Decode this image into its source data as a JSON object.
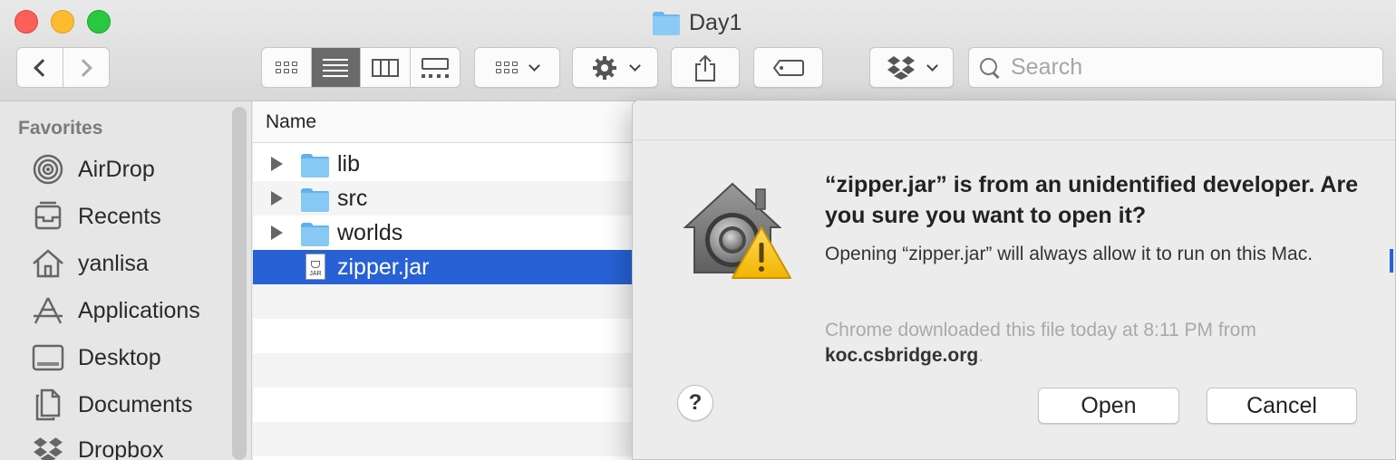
{
  "window": {
    "title": "Day1"
  },
  "toolbar": {
    "search_placeholder": "Search"
  },
  "sidebar": {
    "section": "Favorites",
    "items": [
      {
        "label": "AirDrop",
        "icon": "airdrop-icon"
      },
      {
        "label": "Recents",
        "icon": "recents-icon"
      },
      {
        "label": "yanlisa",
        "icon": "home-icon"
      },
      {
        "label": "Applications",
        "icon": "applications-icon"
      },
      {
        "label": "Desktop",
        "icon": "desktop-icon"
      },
      {
        "label": "Documents",
        "icon": "documents-icon"
      },
      {
        "label": "Dropbox",
        "icon": "dropbox-icon"
      }
    ]
  },
  "filelist": {
    "column_name": "Name",
    "rows": [
      {
        "name": "lib",
        "type": "folder"
      },
      {
        "name": "src",
        "type": "folder"
      },
      {
        "name": "worlds",
        "type": "folder"
      },
      {
        "name": "zipper.jar",
        "type": "jar",
        "selected": true
      }
    ],
    "jar_badge": "JAR"
  },
  "dialog": {
    "title": "“zipper.jar” is from an unidentified developer. Are you sure you want to open it?",
    "message": "Opening “zipper.jar” will always allow it to run on this Mac.",
    "source_prefix": "Chrome downloaded this file today at 8:11 PM from",
    "source_domain": "koc.csbridge.org",
    "source_suffix": ".",
    "help_label": "?",
    "open_label": "Open",
    "cancel_label": "Cancel"
  },
  "colors": {
    "selection": "#2761d5",
    "close": "#fc5f57",
    "minimize": "#fdbc2e",
    "maximize": "#28c840",
    "folder": "#87c8f4"
  }
}
